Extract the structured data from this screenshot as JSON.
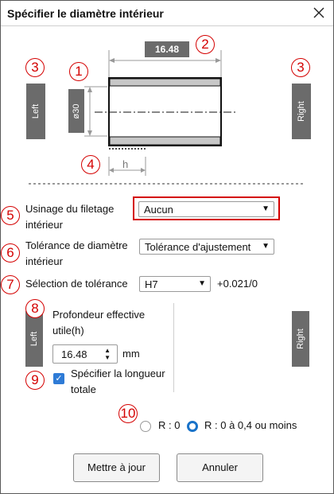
{
  "window": {
    "title": "Spécifier le diamètre intérieur",
    "close_icon": "close-icon"
  },
  "diagram": {
    "length_label": "16.48",
    "diameter_label": "ø30",
    "h_label": "h",
    "left_tab": "Left",
    "right_tab": "Right",
    "markers": [
      "1",
      "2",
      "3",
      "3",
      "4"
    ]
  },
  "form": {
    "thread": {
      "number": "5",
      "label": "Usinage du filetage intérieur",
      "value": "Aucun"
    },
    "tolerance_type": {
      "number": "6",
      "label": "Tolérance de diamètre intérieur",
      "value": "Tolérance d'ajustement"
    },
    "tolerance_sel": {
      "number": "7",
      "label": "Sélection de tolérance",
      "value": "H7",
      "suffix": "+0.021/0"
    },
    "depth": {
      "number": "8",
      "label": "Profondeur effective utile(h)",
      "value": "16.48",
      "unit": "mm"
    },
    "total_length": {
      "number": "9",
      "label": "Spécifier la longueur totale",
      "checked": true
    },
    "left_tab": "Left",
    "right_tab": "Right"
  },
  "radius": {
    "number": "10",
    "option_a": "R : 0",
    "option_b": "R : 0 à 0,4 ou moins",
    "selected": "option_b"
  },
  "buttons": {
    "update": "Mettre à jour",
    "cancel": "Annuler"
  },
  "colors": {
    "accent": "#d40000",
    "gray": "#6b6b6b",
    "check": "#2e7bd6",
    "radio": "#1a73c9"
  }
}
